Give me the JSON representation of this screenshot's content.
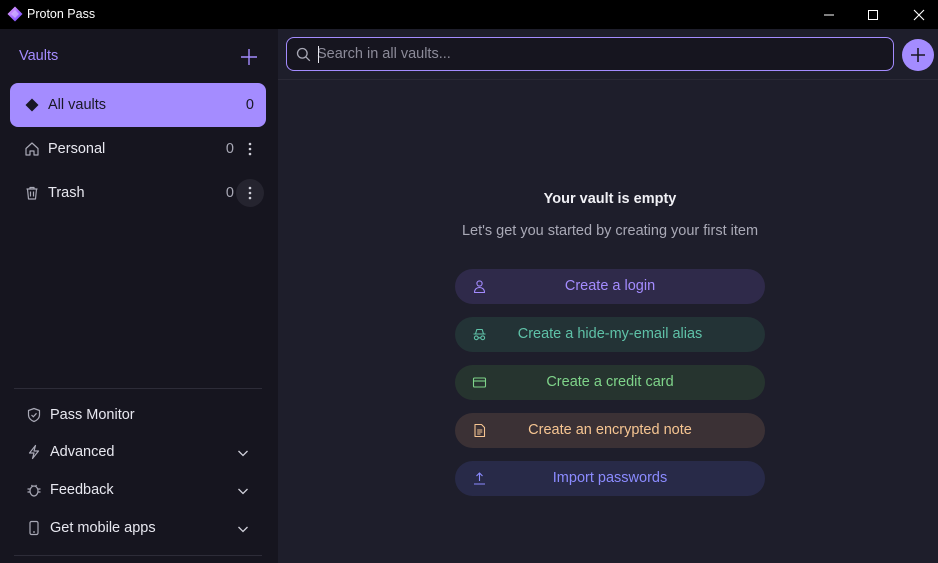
{
  "window": {
    "title": "Proton Pass"
  },
  "sidebar": {
    "vaults_title": "Vaults",
    "vaults": [
      {
        "label": "All vaults",
        "count": "0",
        "icon": "vault-diamond-icon",
        "active": true
      },
      {
        "label": "Personal",
        "count": "0",
        "icon": "home-icon",
        "active": false
      },
      {
        "label": "Trash",
        "count": "0",
        "icon": "trash-icon",
        "active": false
      }
    ],
    "links": [
      {
        "label": "Pass Monitor",
        "icon": "shield-check-icon"
      },
      {
        "label": "Advanced",
        "icon": "bolt-icon"
      },
      {
        "label": "Feedback",
        "icon": "bug-icon"
      },
      {
        "label": "Get mobile apps",
        "icon": "mobile-icon"
      }
    ]
  },
  "search": {
    "placeholder": "Search in all vaults..."
  },
  "empty_state": {
    "title": "Your vault is empty",
    "subtitle": "Let's get you started by creating your first item",
    "actions": [
      {
        "label": "Create a login",
        "icon": "user-icon",
        "color": "#a48cff",
        "bg": "#2f2a4a"
      },
      {
        "label": "Create a hide-my-email alias",
        "icon": "incognito-icon",
        "color": "#5fc2a8",
        "bg": "#233336"
      },
      {
        "label": "Create a credit card",
        "icon": "credit-card-icon",
        "color": "#7fd48a",
        "bg": "#26342f"
      },
      {
        "label": "Create an encrypted note",
        "icon": "note-icon",
        "color": "#f6c592",
        "bg": "#3b3135"
      },
      {
        "label": "Import passwords",
        "icon": "upload-icon",
        "color": "#8b8bff",
        "bg": "#282a48"
      }
    ]
  },
  "colors": {
    "accent": "#a48cff",
    "sidebar_bg": "#16151f",
    "main_bg": "#1e1e2b"
  }
}
